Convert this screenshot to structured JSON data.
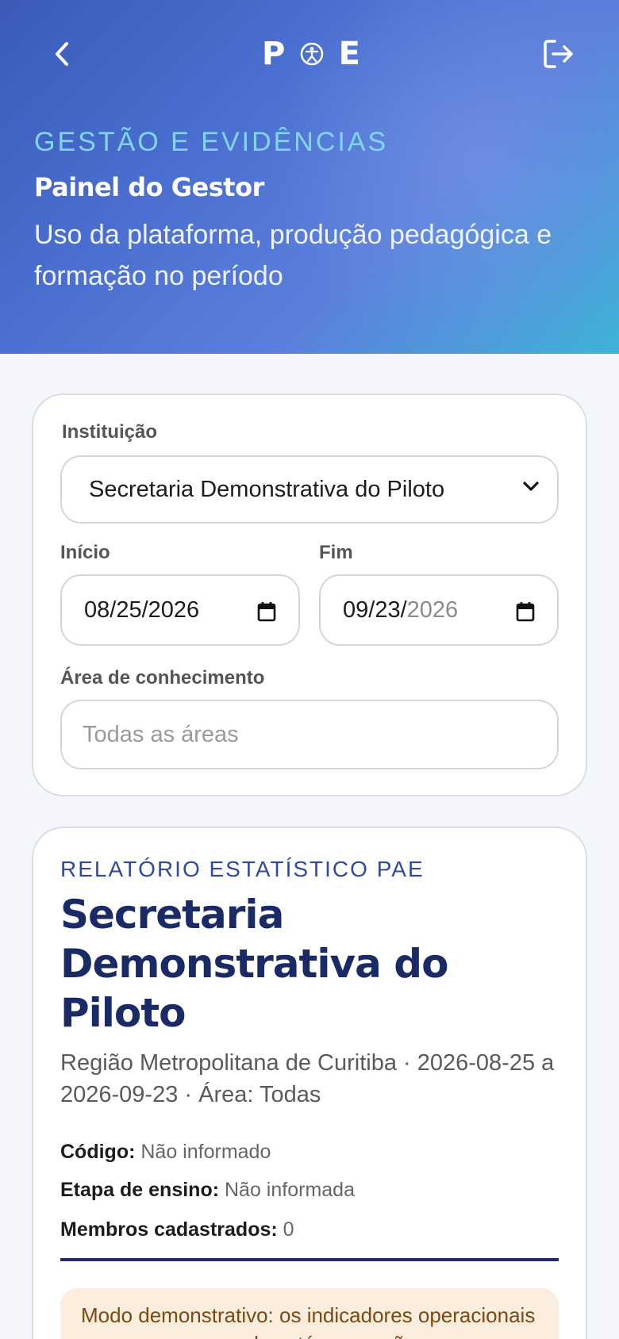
{
  "header": {
    "logo_left": "P",
    "logo_right": "E",
    "eyebrow": "GESTÃO E EVIDÊNCIAS",
    "title": "Painel do Gestor",
    "subtitle": "Uso da plataforma, produção pedagógica e formação no período"
  },
  "filters": {
    "institution_label": "Instituição",
    "institution_value": "Secretaria Demonstrativa do Piloto",
    "start_label": "Início",
    "start_value": "08/25/2026",
    "end_label": "Fim",
    "end_value_main": "09/23/",
    "end_value_dim": "2026",
    "area_label": "Área de conhecimento",
    "area_placeholder": "Todas as áreas"
  },
  "report": {
    "eyebrow": "RELATÓRIO ESTATÍSTICO PAE",
    "title": "Secretaria Demonstrativa do Piloto",
    "meta": "Região Metropolitana de Curitiba · 2026-08-25 a 2026-09-23 · Área: Todas",
    "code_label": "Código:",
    "code_value": "Não informado",
    "stage_label": "Etapa de ensino:",
    "stage_value": "Não informada",
    "members_label": "Membros cadastrados:",
    "members_value": "0",
    "notice": "Modo demonstrativo: os indicadores operacionais permanecem zerados até a conexão"
  },
  "colors": {
    "accent_dark": "#1a2a66",
    "eyebrow_cyan": "#7fd6ee",
    "notice_bg": "#fbeede"
  }
}
